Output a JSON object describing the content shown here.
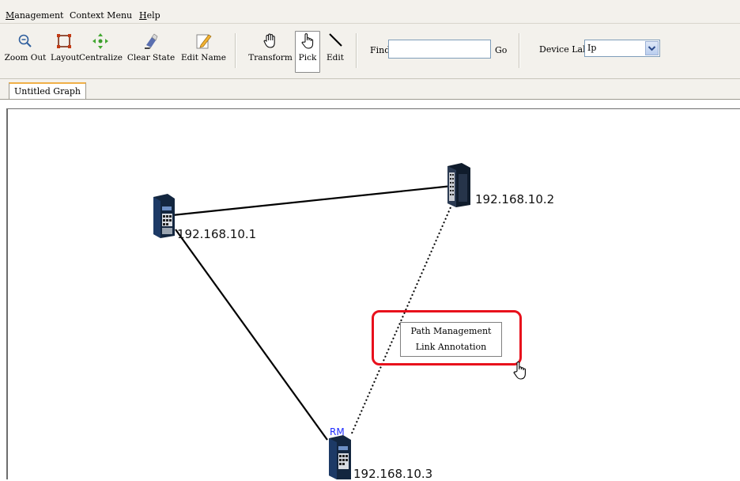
{
  "menubar": {
    "items": [
      {
        "prefix": "",
        "acc": "M",
        "rest": "anagement"
      },
      {
        "prefix": "Context Menu",
        "acc": "",
        "rest": ""
      },
      {
        "prefix": "",
        "acc": "H",
        "rest": "elp"
      }
    ]
  },
  "toolbar": {
    "buttons": [
      {
        "label": "Zoom Out",
        "icon": "zoom-out-icon"
      },
      {
        "label": "Layout",
        "icon": "layout-icon"
      },
      {
        "label": "Centralize",
        "icon": "centralize-icon"
      },
      {
        "label": "Clear State",
        "icon": "clear-state-icon"
      },
      {
        "label": "Edit Name",
        "icon": "edit-name-icon"
      },
      {
        "label": "Transform",
        "icon": "hand-icon"
      },
      {
        "label": "Pick",
        "icon": "pointer-hand-icon",
        "selected": true
      },
      {
        "label": "Edit",
        "icon": "line-icon"
      }
    ],
    "find_label": "Find",
    "find_value": "",
    "go_label": "Go",
    "device_label": "Device Label",
    "device_label_value": "Ip"
  },
  "tabs": [
    {
      "label": "Untitled Graph",
      "active": true
    }
  ],
  "graph": {
    "nodes": [
      {
        "id": "n1",
        "label": "192.168.10.1"
      },
      {
        "id": "n2",
        "label": "192.168.10.2"
      },
      {
        "id": "n3",
        "label": "192.168.10.3",
        "badge": "RM"
      }
    ],
    "links": [
      {
        "from": "n1",
        "to": "n2",
        "style": "solid"
      },
      {
        "from": "n1",
        "to": "n3",
        "style": "solid"
      },
      {
        "from": "n2",
        "to": "n3",
        "style": "dotted"
      }
    ]
  },
  "context_menu": {
    "items": [
      "Path Management",
      "Link Annotation"
    ]
  },
  "colors": {
    "chrome_bg": "#f3f1ec",
    "highlight": "#e8101c",
    "rm_badge": "#1f2cff",
    "tab_accent": "#f0b048"
  }
}
